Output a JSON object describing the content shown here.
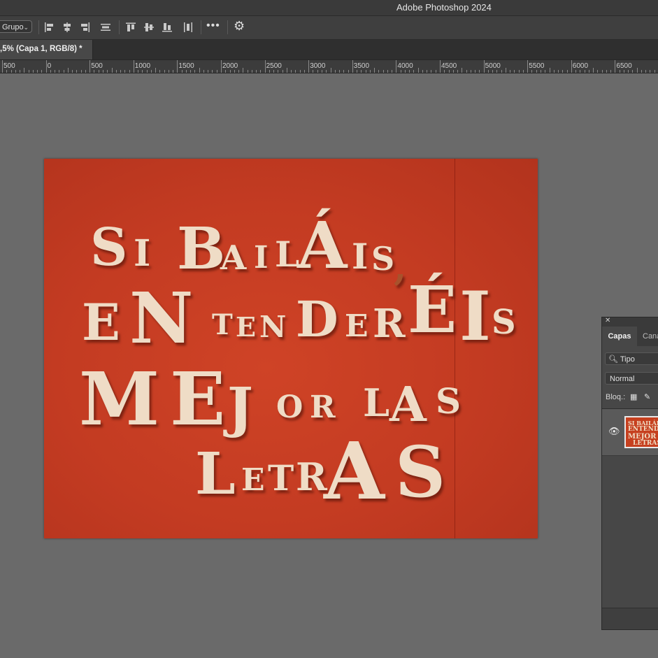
{
  "window": {
    "title": "Adobe Photoshop 2024"
  },
  "options_bar": {
    "auto_select_value": "Grupo",
    "icons": [
      "align-left-icon",
      "align-horizontal-center-icon",
      "align-right-icon",
      "distribute-horizontal-icon",
      "align-top-icon",
      "align-vertical-center-icon",
      "align-bottom-icon",
      "distribute-vertical-icon"
    ],
    "more_label": "•••",
    "settings_icon": "gear-icon"
  },
  "document_tab": {
    "label": ",5% (Capa 1, RGB/8) *"
  },
  "ruler": {
    "labels": [
      "500",
      "0",
      "500",
      "1000",
      "1500",
      "2000",
      "2500",
      "3000",
      "3500",
      "4000",
      "4500",
      "5000",
      "5500",
      "6000",
      "6500"
    ]
  },
  "canvas": {
    "background_color": "#c63f22",
    "letter_color": "#efdcc6",
    "artwork_text": "SI BAILÁIS, ENTENDERÉIS MEJOR LAS LETRAS"
  },
  "layers_panel": {
    "tabs": [
      "Capas",
      "Cana"
    ],
    "filter_label": "Tipo",
    "blend_mode": "Normal",
    "lock_label": "Bloq.:",
    "thumbnail_text": "SI BAILÁIS ENTENDERÉIS MEJOR LAS LETRAS"
  }
}
